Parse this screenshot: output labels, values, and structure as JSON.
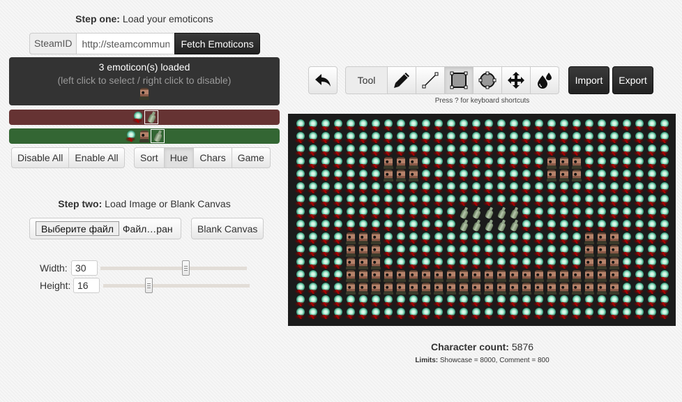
{
  "step_one": {
    "title_bold": "Step one:",
    "title_rest": " Load your emoticons",
    "steamid_label": "SteamID",
    "url_value": "http://steamcommunity.com/",
    "fetch_label": "Fetch Emoticons",
    "loaded_text": "3 emoticon(s) loaded",
    "hint_text": "(left click to select / right click to disable)",
    "loaded_emoticons": [
      "face"
    ],
    "bar_left_color": "#663333",
    "bar_right_color": "#336633",
    "bar_left_emoticons": [
      {
        "type": "glow",
        "selected": false
      },
      {
        "type": "bottle",
        "selected": true
      }
    ],
    "bar_right_emoticons": [
      {
        "type": "glow",
        "selected": false
      },
      {
        "type": "face",
        "selected": false
      },
      {
        "type": "bottle",
        "selected": true
      }
    ],
    "disable_all": "Disable All",
    "enable_all": "Enable All",
    "sort_buttons": [
      {
        "label": "Sort",
        "active": false
      },
      {
        "label": "Hue",
        "active": true
      },
      {
        "label": "Chars",
        "active": false
      },
      {
        "label": "Game",
        "active": false
      }
    ]
  },
  "step_two": {
    "title_bold": "Step two:",
    "title_rest": " Load Image or Blank Canvas",
    "file_button": "Выберите файл",
    "file_name": "Файл…ран",
    "blank_canvas": "Blank Canvas",
    "width_label": "Width:",
    "width_value": "30",
    "width_slider_fraction": 0.58,
    "height_label": "Height:",
    "height_value": "16",
    "height_slider_fraction": 0.31
  },
  "toolbar": {
    "undo_icon": "undo-arrow-icon",
    "tool_label": "Tool",
    "tools": [
      {
        "name": "pencil",
        "icon": "pencil-icon",
        "active": false
      },
      {
        "name": "line",
        "icon": "line-icon",
        "active": false
      },
      {
        "name": "rectangle",
        "icon": "rectangle-icon",
        "active": true
      },
      {
        "name": "circle",
        "icon": "circle-icon",
        "active": false
      },
      {
        "name": "move",
        "icon": "move-icon",
        "active": false
      },
      {
        "name": "fill",
        "icon": "fill-drops-icon",
        "active": false
      }
    ],
    "import_label": "Import",
    "export_label": "Export",
    "shortcut_hint": "Press ? for keyboard shortcuts"
  },
  "canvas": {
    "columns": 30,
    "rows": 16,
    "background_emoticon": "glow",
    "cells": [
      {
        "rows": [
          4,
          5
        ],
        "cols": [
          8,
          10
        ],
        "type": "face"
      },
      {
        "rows": [
          4,
          5
        ],
        "cols": [
          21,
          23
        ],
        "type": "face"
      },
      {
        "rows": [
          8,
          9
        ],
        "cols": [
          14,
          18
        ],
        "type": "bottle"
      },
      {
        "rows": [
          10,
          12
        ],
        "cols": [
          5,
          7
        ],
        "type": "face"
      },
      {
        "rows": [
          10,
          12
        ],
        "cols": [
          24,
          26
        ],
        "type": "face"
      },
      {
        "rows": [
          13,
          14
        ],
        "cols": [
          5,
          26
        ],
        "type": "face"
      }
    ]
  },
  "stats": {
    "char_count_label": "Character count:",
    "char_count_value": "5876",
    "limits_label": "Limits:",
    "limits_text": " Showcase = 8000, Comment = 800"
  }
}
